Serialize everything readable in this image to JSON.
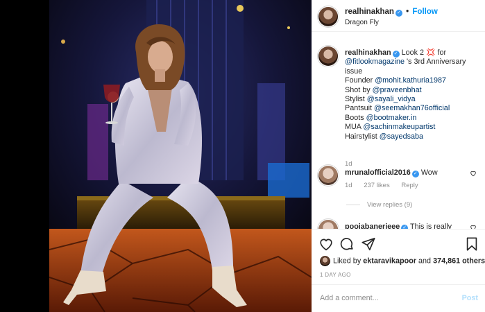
{
  "header": {
    "username": "realhinakhan",
    "verified_badge": "✓",
    "separator": "•",
    "follow_label": "Follow",
    "location": "Dragon Fly"
  },
  "caption": {
    "username": "realhinakhan",
    "line1": "Look 2",
    "emoji": "💢",
    "for": "for",
    "mention_magazine": "@fitlookmagazine",
    "line2_rest": "'s 3rd Anniversary issue",
    "founder_label": "Founder",
    "founder_mention": "@mohit.kathuria1987",
    "shot_label": "Shot by",
    "shot_mention": "@praveenbhat",
    "stylist_label": "Stylist",
    "stylist_mention": "@sayali_vidya",
    "pantsuit_label": "Pantsuit",
    "pantsuit_mention": "@seemakhan76official",
    "boots_label": "Boots",
    "boots_mention": "@bootmaker.in",
    "mua_label": "MUA",
    "mua_mention": "@sachinmakeupartist",
    "hair_label": "Hairstylist",
    "hair_mention": "@sayedsaba",
    "age": "1d"
  },
  "comments": [
    {
      "username": "mrunalofficial2016",
      "text": "Wow",
      "age": "1d",
      "likes": "237 likes",
      "reply_label": "Reply"
    },
    {
      "username": "poojabanerjeee",
      "text": "This is really"
    }
  ],
  "view_replies": "View replies (9)",
  "likes": {
    "prefix": "Liked by",
    "user": "ektaravikapoor",
    "and": "and",
    "count": "374,861 others"
  },
  "timestamp": "1 DAY AGO",
  "add_comment": {
    "placeholder": "Add a comment...",
    "post_label": "Post"
  },
  "colors": {
    "accent": "#0095f6",
    "verified": "#3897f0",
    "mention": "#00376b",
    "muted": "#8e8e8e"
  },
  "icons": [
    "heart-icon",
    "comment-icon",
    "share-icon",
    "bookmark-icon",
    "verified-badge-icon"
  ]
}
